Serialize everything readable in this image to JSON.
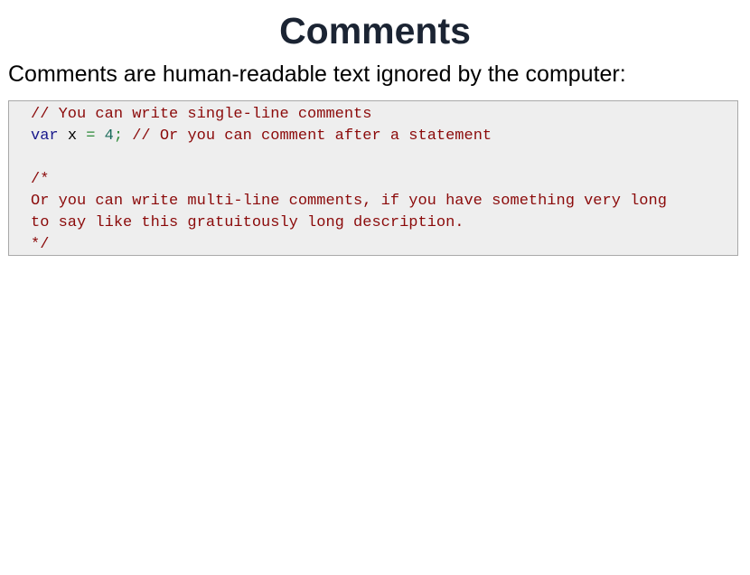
{
  "slide": {
    "title": "Comments",
    "intro": "Comments are human-readable text ignored by the computer:"
  },
  "code": {
    "line1_comment": "// You can write single-line comments",
    "line2_keyword": "var",
    "line2_ident": "x",
    "line2_op": "=",
    "line2_number": "4",
    "line2_semicolon": ";",
    "line2_comment": "// Or you can comment after a statement",
    "line4_comment": "/*",
    "line5_comment": "Or you can write multi-line comments, if you have something very long",
    "line6_comment": "to say like this gratuitously long description.",
    "line7_comment": "*/"
  },
  "colors": {
    "comment": "#8b0a0a",
    "keyword": "#1a1a8c",
    "operator": "#2e8b3a",
    "number": "#1a6b5a",
    "code_background": "#eeeeee",
    "title_text": "#1b2433"
  }
}
